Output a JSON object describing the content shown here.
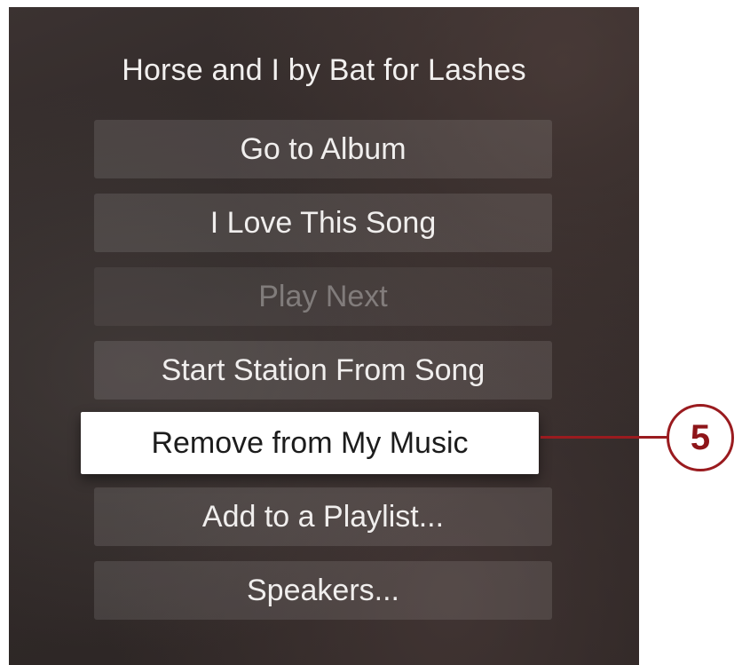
{
  "menu": {
    "title": "Horse and I by Bat for Lashes",
    "options": [
      {
        "label": "Go to Album",
        "state": "normal"
      },
      {
        "label": "I Love This Song",
        "state": "normal"
      },
      {
        "label": "Play Next",
        "state": "disabled"
      },
      {
        "label": "Start Station From Song",
        "state": "normal"
      },
      {
        "label": "Remove from My Music",
        "state": "focused"
      },
      {
        "label": "Add to a Playlist...",
        "state": "normal"
      },
      {
        "label": "Speakers...",
        "state": "normal"
      }
    ]
  },
  "callout": {
    "number": "5",
    "color": "#9a1b1f"
  }
}
